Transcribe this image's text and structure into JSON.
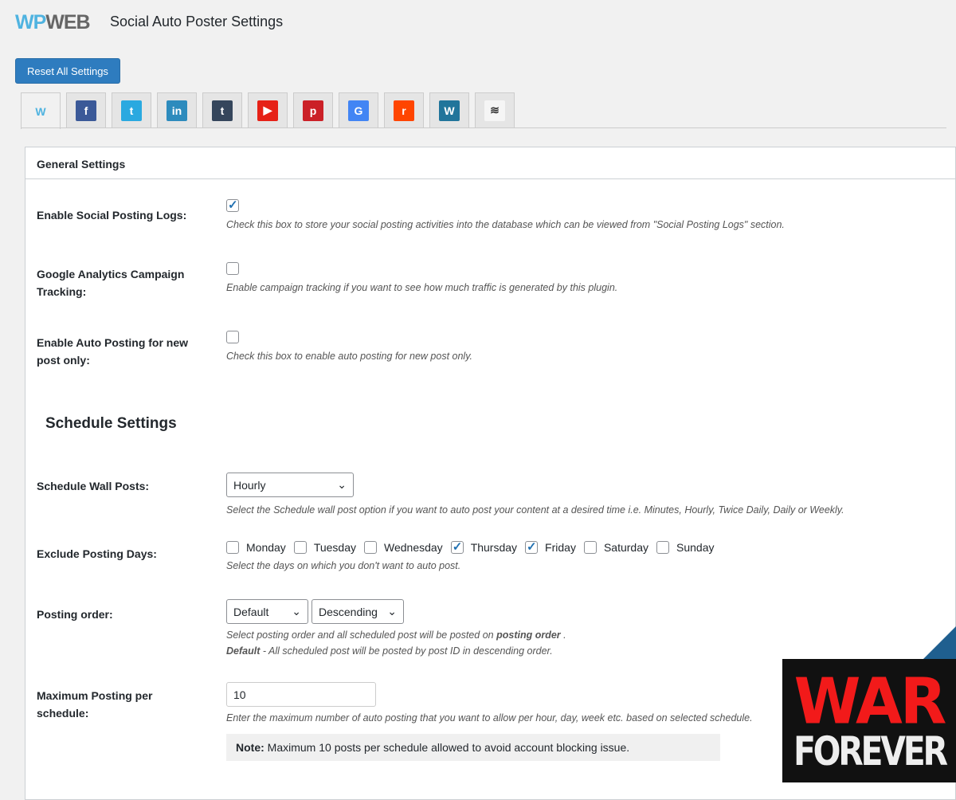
{
  "header": {
    "logo_wp": "WP",
    "logo_web": "WEB",
    "title": "Social Auto Poster Settings",
    "reset_label": "Reset All Settings"
  },
  "tabs": [
    {
      "icon": "wpweb-icon",
      "glyph": "W",
      "color": "#4fb3e0"
    },
    {
      "icon": "facebook-icon",
      "glyph": "f",
      "color": "#3b5998"
    },
    {
      "icon": "twitter-icon",
      "glyph": "t",
      "color": "#2aa9e0"
    },
    {
      "icon": "linkedin-icon",
      "glyph": "in",
      "color": "#2d8bbd"
    },
    {
      "icon": "tumblr-icon",
      "glyph": "t",
      "color": "#35465c"
    },
    {
      "icon": "youtube-icon",
      "glyph": "▶",
      "color": "#e62117"
    },
    {
      "icon": "pinterest-icon",
      "glyph": "p",
      "color": "#cb2027"
    },
    {
      "icon": "google-business-icon",
      "glyph": "G",
      "color": "#4285f4"
    },
    {
      "icon": "reddit-icon",
      "glyph": "r",
      "color": "#ff4500"
    },
    {
      "icon": "wordpress-icon",
      "glyph": "W",
      "color": "#21759b"
    },
    {
      "icon": "buffer-icon",
      "glyph": "≋",
      "color": "#333333"
    }
  ],
  "general": {
    "heading": "General Settings",
    "logs": {
      "label": "Enable Social Posting Logs:",
      "checked": true,
      "desc": "Check this box to store your social posting activities into the database which can be viewed from \"Social Posting Logs\" section."
    },
    "ga": {
      "label": "Google Analytics Campaign Tracking:",
      "checked": false,
      "desc": "Enable campaign tracking if you want to see how much traffic is generated by this plugin."
    },
    "newpost": {
      "label": "Enable Auto Posting for new post only:",
      "checked": false,
      "desc": "Check this box to enable auto posting for new post only."
    }
  },
  "schedule": {
    "heading": "Schedule Settings",
    "wall": {
      "label": "Schedule Wall Posts:",
      "value": "Hourly",
      "desc": "Select the Schedule wall post option if you want to auto post your content at a desired time i.e. Minutes, Hourly, Twice Daily, Daily or Weekly."
    },
    "exclude": {
      "label": "Exclude Posting Days:",
      "days": [
        {
          "name": "Monday",
          "checked": false
        },
        {
          "name": "Tuesday",
          "checked": false
        },
        {
          "name": "Wednesday",
          "checked": false
        },
        {
          "name": "Thursday",
          "checked": true
        },
        {
          "name": "Friday",
          "checked": true
        },
        {
          "name": "Saturday",
          "checked": false
        },
        {
          "name": "Sunday",
          "checked": false
        }
      ],
      "desc": "Select the days on which you don't want to auto post."
    },
    "order": {
      "label": "Posting order:",
      "order_value": "Default",
      "direction_value": "Descending",
      "desc_pre": "Select posting order and all scheduled post will be posted on ",
      "desc_bold": "posting order",
      "desc_post": " .",
      "desc2_bold": "Default",
      "desc2_rest": " - All scheduled post will be posted by post ID in descending order."
    },
    "max": {
      "label": "Maximum Posting per schedule:",
      "value": "10",
      "desc": "Enter the maximum number of auto posting that you want to allow per hour, day, week etc. based on selected schedule.",
      "note_bold": "Note:",
      "note_rest": " Maximum 10 posts per schedule allowed to avoid account blocking issue."
    }
  },
  "watermark": {
    "line1": "WAR",
    "line2": "FOREVER"
  }
}
